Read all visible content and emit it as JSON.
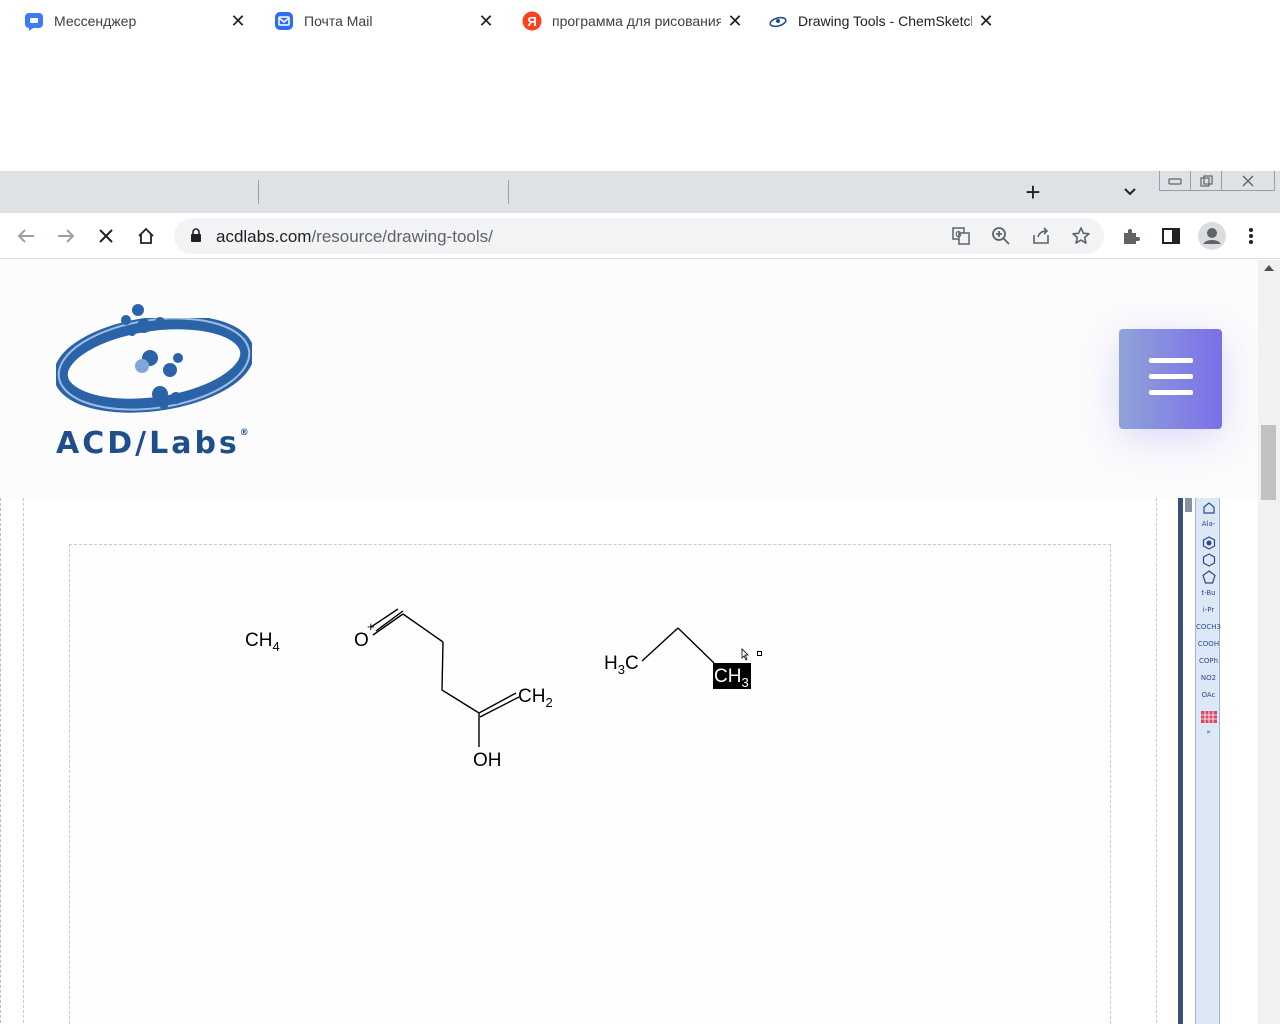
{
  "browser": {
    "tabs": [
      {
        "label": "Мессенджер",
        "icon": "messenger-icon",
        "color": "#3d7bf7"
      },
      {
        "label": "Почта Mail",
        "icon": "mail-icon",
        "color": "#2d6cf5"
      },
      {
        "label": "программа для рисования",
        "icon": "yandex-icon",
        "color": "#fc3f1d"
      },
      {
        "label": "Drawing Tools - ChemSketch",
        "icon": "acdlabs-favicon-icon",
        "color": "#1f4f8b",
        "active": true
      }
    ],
    "url": {
      "host": "acdlabs.com",
      "path": "/resource/drawing-tools/"
    }
  },
  "site": {
    "logo_text": "ACD/Labs",
    "logo_mark": "®",
    "brand_color": "#1f4f8b",
    "menu_gradient": [
      "#8fa3d8",
      "#7b6fe8"
    ]
  },
  "sketch": {
    "molecule1": {
      "label": "CH",
      "sub": "4"
    },
    "molecule2": {
      "oxygen": "O",
      "charge": "+",
      "ch2": "CH",
      "ch2_sub": "2",
      "oh": "OH"
    },
    "molecule3": {
      "h3c_h": "H",
      "h3c_sub": "3",
      "h3c_c": "C",
      "ch3": "CH",
      "ch3_sub": "3"
    }
  },
  "side_toolbar": {
    "items": [
      "Ala-",
      "t-Bu",
      "i-Pr",
      "COCH3",
      "COOH",
      "COPh",
      "NO2",
      "OAc"
    ]
  }
}
